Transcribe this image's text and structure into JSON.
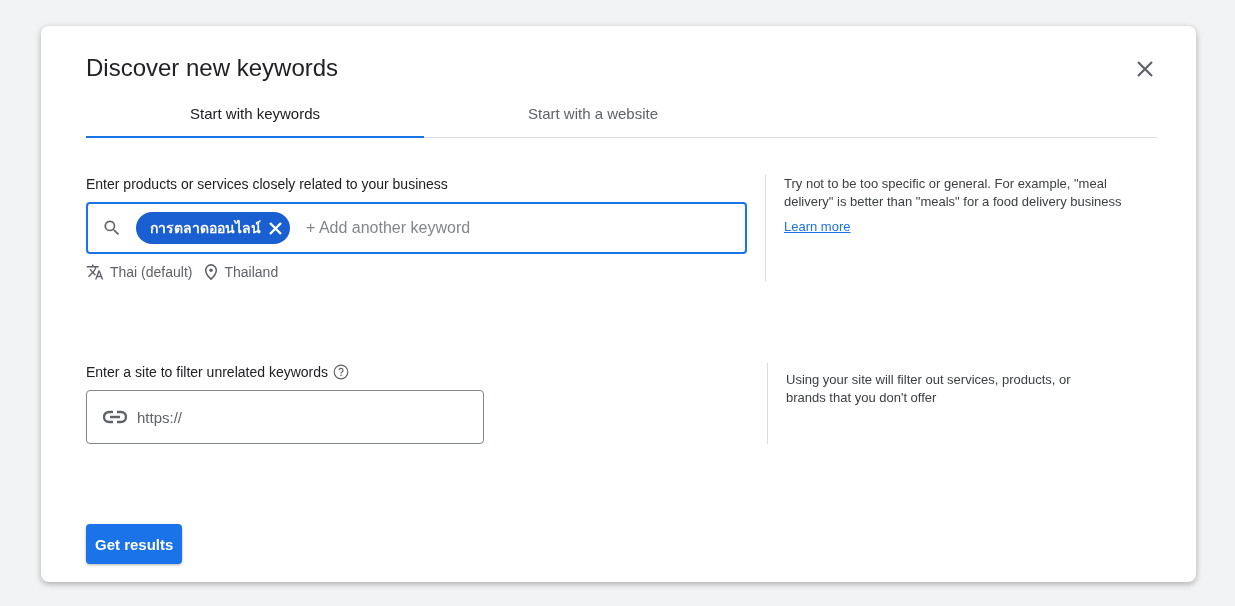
{
  "dialog": {
    "title": "Discover new keywords"
  },
  "tabs": [
    {
      "label": "Start with keywords",
      "selected": true
    },
    {
      "label": "Start with a website",
      "selected": false
    }
  ],
  "keywords_section": {
    "label": "Enter products or services closely related to your business",
    "chips": [
      "การตลาดออนไลน์"
    ],
    "placeholder": "+ Add another keyword",
    "language": "Thai (default)",
    "location": "Thailand",
    "help_text": "Try not to be too specific or general. For example, \"meal delivery\" is better than \"meals\" for a food delivery business",
    "help_link": "Learn more"
  },
  "site_section": {
    "label": "Enter a site to filter unrelated keywords",
    "placeholder": "https://",
    "help_text": "Using your site will filter out services, products, or brands that you don't offer"
  },
  "primary_button": "Get results"
}
